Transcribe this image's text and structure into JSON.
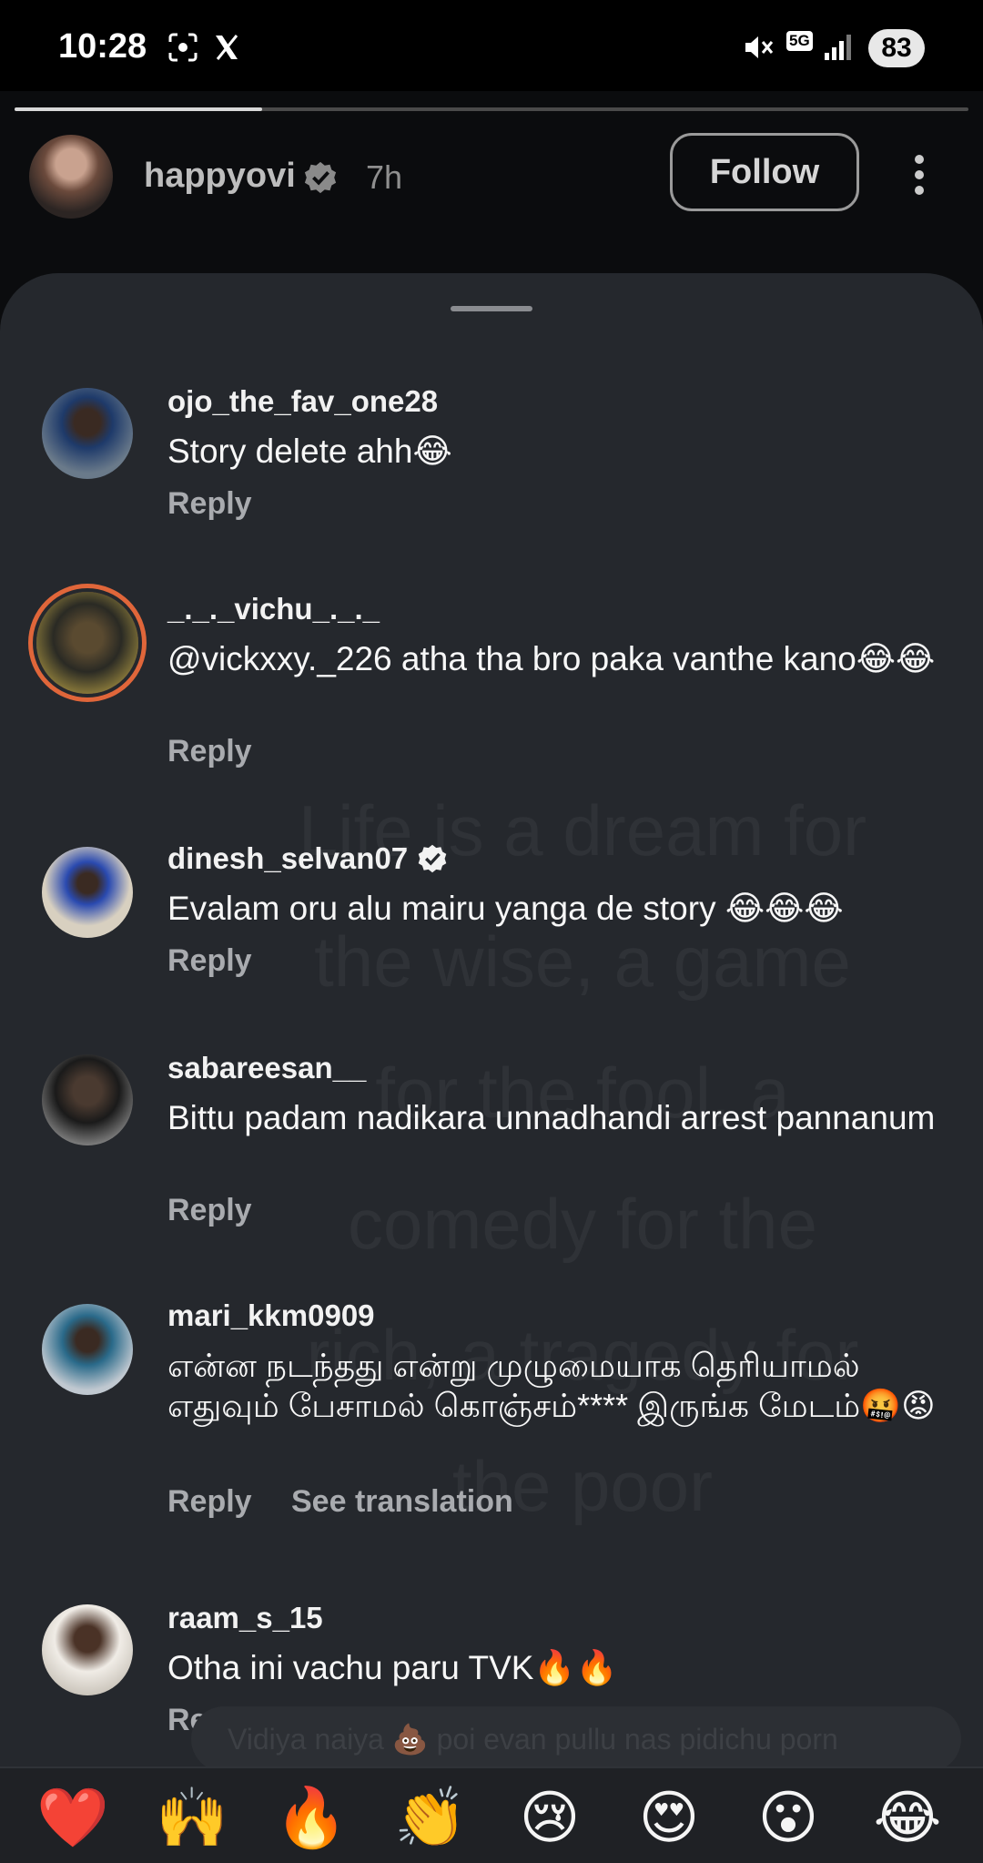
{
  "status_bar": {
    "time": "10:28",
    "battery": "83",
    "network": "5G"
  },
  "story": {
    "username": "happyovi",
    "time_ago": "7h",
    "follow_label": "Follow",
    "progress": 0.26
  },
  "background_quote": "Life is a dream for\nthe wise, a game\nfor the fool, a\ncomedy for the\nrich, a tragedy for\nthe poor",
  "comments": [
    {
      "username": "ojo_the_fav_one28",
      "text": "Story delete ahh😂",
      "reply": "Reply"
    },
    {
      "username": "_._._vichu_._._",
      "text": "@vickxxy._226 atha tha bro paka vanthe kano😂😂",
      "reply": "Reply"
    },
    {
      "username": "dinesh_selvan07",
      "text": "Evalam oru alu mairu yanga de story 😂😂😂",
      "reply": "Reply"
    },
    {
      "username": "sabareesan__",
      "text": "Bittu padam nadikara unnadhandi arrest pannanum",
      "reply": "Reply"
    },
    {
      "username": "mari_kkm0909",
      "text": "என்ன நடந்தது என்று முழுமையாக தெரியாமல் எதுவும் பேசாமல் கொஞ்சம்**** இருங்க மேடம்🤬😡",
      "reply": "Reply",
      "translate": "See translation"
    },
    {
      "username": "raam_s_15",
      "text": "Otha ini vachu paru TVK🔥🔥",
      "reply": "Reply"
    }
  ],
  "ghost_input": "Vidiya naiya 💩 poi evan pullu nas pidichu porn",
  "emoji_bar": [
    "❤️",
    "🙌",
    "🔥",
    "👏",
    "😢",
    "😍",
    "😮",
    "😂"
  ]
}
